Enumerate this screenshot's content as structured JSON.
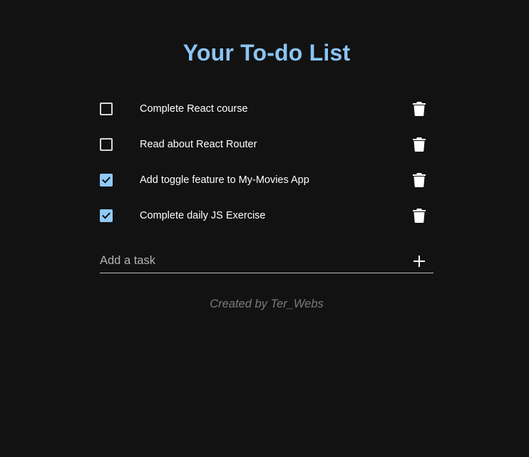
{
  "header": {
    "title": "Your To-do List"
  },
  "todos": [
    {
      "text": "Complete React course",
      "completed": false
    },
    {
      "text": "Read about React Router",
      "completed": false
    },
    {
      "text": "Add toggle feature to My-Movies App",
      "completed": true
    },
    {
      "text": "Complete daily JS Exercise",
      "completed": true
    }
  ],
  "add_task": {
    "placeholder": "Add a task",
    "value": ""
  },
  "footer": {
    "credit": "Created by Ter_Webs"
  },
  "icons": {
    "delete": "trash-icon",
    "add": "plus-icon",
    "checked": "check-icon"
  },
  "colors": {
    "background": "#121212",
    "accent": "#90caf9",
    "title": "#8cc4f3",
    "text": "#ffffff",
    "muted": "#7b7b7b"
  }
}
